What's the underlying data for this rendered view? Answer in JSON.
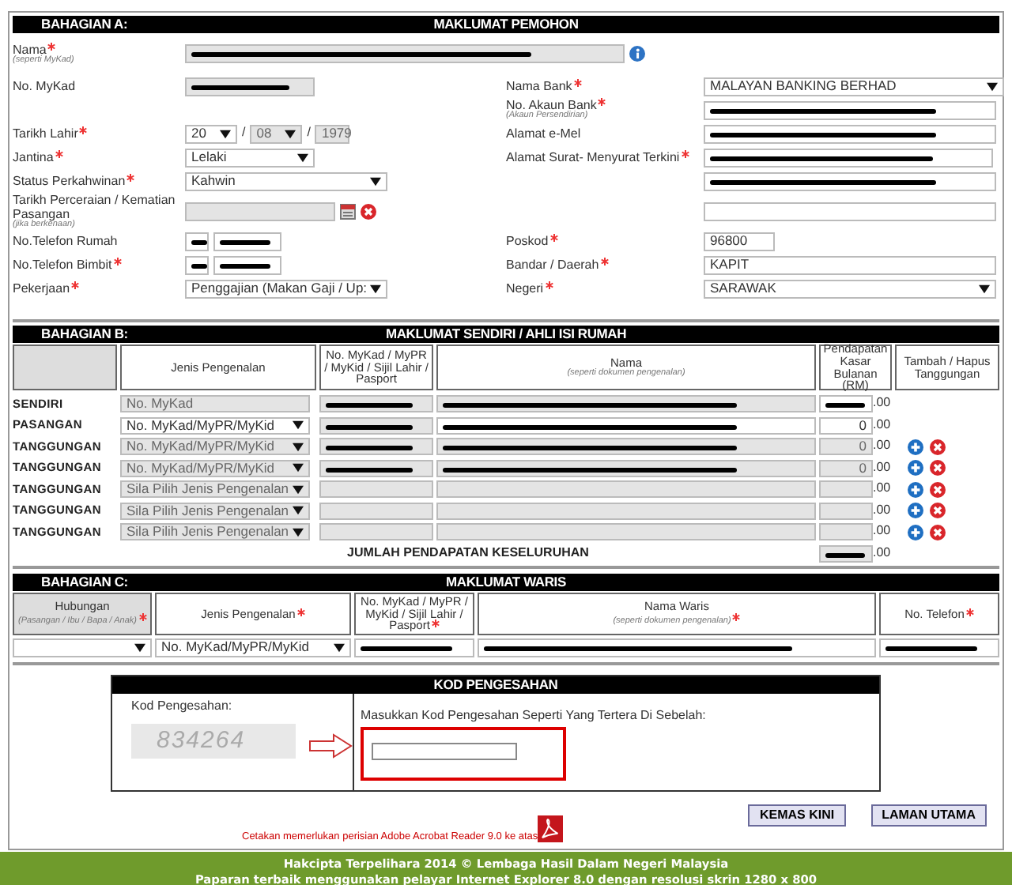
{
  "section_a": {
    "part": "BAHAGIAN A:",
    "title": "MAKLUMAT PEMOHON",
    "name_row": {
      "label": "Nama",
      "required": true,
      "hint": "(seperti MyKad)",
      "info": true,
      "fields": [
        {
          "kind": "text",
          "redacted": true,
          "disabled": true
        }
      ]
    },
    "left": [
      {
        "label": "No. MyKad",
        "required": false,
        "fields": [
          {
            "kind": "text",
            "redacted": true,
            "disabled": true
          }
        ]
      },
      {
        "label": "Tarikh Lahir",
        "required": true,
        "fields": [
          {
            "kind": "select",
            "value": "20",
            "disabled": false
          },
          {
            "kind": "sep",
            "value": "/"
          },
          {
            "kind": "select",
            "value": "08",
            "disabled": true
          },
          {
            "kind": "sep",
            "value": "/"
          },
          {
            "kind": "text",
            "value": "1979",
            "disabled": true
          }
        ]
      },
      {
        "label": "Jantina",
        "required": true,
        "fields": [
          {
            "kind": "select",
            "value": "Lelaki",
            "disabled": false
          }
        ]
      },
      {
        "label": "Status Perkahwinan",
        "required": true,
        "fields": [
          {
            "kind": "select",
            "value": "Kahwin",
            "disabled": false
          }
        ]
      },
      {
        "label": "Tarikh Perceraian / Kematian Pasangan",
        "required": false,
        "hint": "(jika berkenaan)",
        "picker": true,
        "fields": [
          {
            "kind": "text",
            "disabled": true
          }
        ]
      },
      {
        "label": "No.Telefon Rumah",
        "required": false,
        "fields": [
          {
            "kind": "text",
            "redacted": true,
            "disabled": false
          },
          {
            "kind": "text",
            "redacted": true,
            "disabled": false
          }
        ]
      },
      {
        "label": "No.Telefon Bimbit",
        "required": true,
        "fields": [
          {
            "kind": "text",
            "redacted": true,
            "disabled": false
          },
          {
            "kind": "text",
            "redacted": true,
            "disabled": false
          }
        ]
      },
      {
        "label": "Pekerjaan",
        "required": true,
        "fields": [
          {
            "kind": "select",
            "value": "Penggajian (Makan Gaji / Up:",
            "disabled": false
          }
        ]
      }
    ],
    "right": [
      {
        "label": "Nama Bank",
        "required": true,
        "fields": [
          {
            "kind": "select",
            "value": "MALAYAN BANKING BERHAD",
            "disabled": false
          }
        ]
      },
      {
        "label": "No. Akaun Bank",
        "required": true,
        "hint": "(Akaun Persendirian)",
        "fields": [
          {
            "kind": "text",
            "redacted": true,
            "disabled": false
          }
        ]
      },
      {
        "label": "Alamat e-Mel",
        "required": false,
        "fields": [
          {
            "kind": "text",
            "redacted": true,
            "disabled": false
          }
        ]
      },
      {
        "label": "Alamat Surat- Menyurat Terkini",
        "required": true,
        "fields": [
          {
            "kind": "text",
            "redacted": true,
            "disabled": false
          }
        ]
      },
      {
        "fields": [
          {
            "kind": "text",
            "redacted": true,
            "disabled": false
          }
        ]
      },
      {
        "fields": [
          {
            "kind": "text",
            "disabled": false
          }
        ]
      },
      {
        "label": "Poskod",
        "required": true,
        "fields": [
          {
            "kind": "text",
            "value": "96800",
            "disabled": false
          }
        ]
      },
      {
        "label": "Bandar / Daerah",
        "required": true,
        "fields": [
          {
            "kind": "text",
            "value": "KAPIT",
            "disabled": false
          }
        ]
      },
      {
        "label": "Negeri",
        "required": true,
        "fields": [
          {
            "kind": "select",
            "value": "SARAWAK",
            "disabled": false
          }
        ]
      }
    ]
  },
  "section_b": {
    "part": "BAHAGIAN B:",
    "title": "MAKLUMAT SENDIRI / AHLI ISI RUMAH",
    "columns": [
      {
        "label": "Jenis Pengenalan"
      },
      {
        "label": "No. MyKad / MyPR / MyKid / Sijil Lahir / Pasport"
      },
      {
        "label": "Nama",
        "hint": "(seperti dokumen pengenalan)"
      },
      {
        "label": "Pendapatan Kasar Bulanan (RM)"
      },
      {
        "label": "Tambah / Hapus Tanggungan"
      }
    ],
    "rows": [
      {
        "label": "SENDIRI",
        "id_type": {
          "kind": "text",
          "value": "No. MyKad",
          "disabled": true
        },
        "mykad": {
          "redacted": true,
          "disabled": true
        },
        "nama": {
          "redacted": true,
          "disabled": true
        },
        "income": {
          "redacted": true,
          "disabled": false
        },
        "decimals": ".00",
        "actions": false
      },
      {
        "label": "PASANGAN",
        "id_type": {
          "kind": "select",
          "value": "No. MyKad/MyPR/MyKid",
          "disabled": false
        },
        "mykad": {
          "redacted": true,
          "disabled": true
        },
        "nama": {
          "redacted": true,
          "disabled": false
        },
        "income": {
          "value": "0",
          "disabled": false
        },
        "decimals": ".00",
        "actions": false
      },
      {
        "label": "TANGGUNGAN",
        "id_type": {
          "kind": "select",
          "value": "No. MyKad/MyPR/MyKid",
          "disabled": true
        },
        "mykad": {
          "redacted": true,
          "disabled": true
        },
        "nama": {
          "redacted": true,
          "disabled": true
        },
        "income": {
          "value": "0",
          "disabled": true
        },
        "decimals": ".00",
        "actions": true
      },
      {
        "label": "TANGGUNGAN",
        "id_type": {
          "kind": "select",
          "value": "No. MyKad/MyPR/MyKid",
          "disabled": true
        },
        "mykad": {
          "redacted": true,
          "disabled": true
        },
        "nama": {
          "redacted": true,
          "disabled": true
        },
        "income": {
          "value": "0",
          "disabled": true
        },
        "decimals": ".00",
        "actions": true
      },
      {
        "label": "TANGGUNGAN",
        "id_type": {
          "kind": "select",
          "value": "Sila Pilih Jenis Pengenalan",
          "disabled": true
        },
        "mykad": {
          "disabled": true
        },
        "nama": {
          "disabled": true
        },
        "income": {
          "disabled": true
        },
        "decimals": ".00",
        "actions": true
      },
      {
        "label": "TANGGUNGAN",
        "id_type": {
          "kind": "select",
          "value": "Sila Pilih Jenis Pengenalan",
          "disabled": true
        },
        "mykad": {
          "disabled": true
        },
        "nama": {
          "disabled": true
        },
        "income": {
          "disabled": true
        },
        "decimals": ".00",
        "actions": true
      },
      {
        "label": "TANGGUNGAN",
        "id_type": {
          "kind": "select",
          "value": "Sila Pilih Jenis Pengenalan",
          "disabled": true
        },
        "mykad": {
          "disabled": true
        },
        "nama": {
          "disabled": true
        },
        "income": {
          "disabled": true
        },
        "decimals": ".00",
        "actions": true
      }
    ],
    "total": {
      "label": "JUMLAH PENDAPATAN KESELURUHAN",
      "income": {
        "redacted": true,
        "disabled": true
      },
      "decimals": ".00"
    }
  },
  "section_c": {
    "part": "BAHAGIAN C:",
    "title": "MAKLUMAT WARIS",
    "columns": [
      {
        "label": "Hubungan",
        "hint": "(Pasangan / Ibu / Bapa / Anak)",
        "required": true,
        "shaded": true
      },
      {
        "label": "Jenis Pengenalan",
        "required": true,
        "shaded": false
      },
      {
        "label": "No. MyKad / MyPR / MyKid / Sijil Lahir / Pasport",
        "required": true,
        "shaded": false
      },
      {
        "label": "Nama Waris",
        "hint": "(seperti dokumen pengenalan)",
        "required": true,
        "shaded": false
      },
      {
        "label": "No. Telefon",
        "required": true,
        "shaded": false
      }
    ],
    "row": [
      {
        "kind": "select",
        "disabled": false
      },
      {
        "kind": "select",
        "value": "No. MyKad/MyPR/MyKid",
        "disabled": false
      },
      {
        "kind": "text",
        "redacted": true,
        "disabled": false
      },
      {
        "kind": "text",
        "redacted": true,
        "disabled": false
      },
      {
        "kind": "text",
        "redacted": true,
        "disabled": false
      }
    ]
  },
  "verification": {
    "title": "KOD PENGESAHAN",
    "label": "Kod Pengesahan:",
    "captcha": "834264",
    "instruction": "Masukkan Kod Pengesahan Seperti Yang Tertera Di Sebelah:"
  },
  "note": "Cetakan memerlukan perisian Adobe Acrobat Reader 9.0 ke atas",
  "buttons": [
    "KEMAS KINI",
    "LAMAN UTAMA"
  ],
  "footer": [
    "Hakcipta Terpelihara 2014 © Lembaga Hasil Dalam Negeri Malaysia",
    "Paparan terbaik menggunakan pelayar Internet Explorer 8.0 dengan resolusi skrin 1280 x 800"
  ]
}
